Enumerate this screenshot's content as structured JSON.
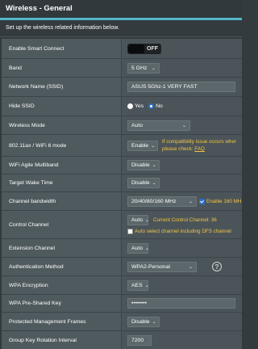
{
  "header": {
    "title": "Wireless - General",
    "description": "Set up the wireless related information below."
  },
  "rows": {
    "smart_connect": {
      "label": "Enable Smart Connect",
      "toggle": "OFF"
    },
    "band": {
      "label": "Band",
      "value": "5 GHz"
    },
    "ssid": {
      "label": "Network Name (SSID)",
      "value": "ASUS 5Ghz-1 VERY FAST"
    },
    "hide_ssid": {
      "label": "Hide SSID",
      "option_yes": "Yes",
      "option_no": "No",
      "selected": "No"
    },
    "wireless_mode": {
      "label": "Wireless Mode",
      "value": "Auto"
    },
    "wifi6": {
      "label": "802.11ax / WiFi 6 mode",
      "value": "Enable",
      "note_line1": "If compatibility issue occurs wher",
      "note_line2_prefix": "please check: ",
      "note_link": "FAQ"
    },
    "agile_multiband": {
      "label": "WiFi Agile Multiband",
      "value": "Disable"
    },
    "target_wake": {
      "label": "Target Wake Time",
      "value": "Disable"
    },
    "channel_bw": {
      "label": "Channel bandwidth",
      "value": "20/40/80/160 MHz",
      "check_label": "Enable 160 MH",
      "checked": true
    },
    "control_channel": {
      "label": "Control Channel",
      "value": "Auto",
      "current": "Current Control Channel: 36",
      "check_label": "Auto select channel including DFS channel",
      "checked": false
    },
    "ext_channel": {
      "label": "Extension Channel",
      "value": "Auto"
    },
    "auth_method": {
      "label": "Authentication Method",
      "value": "WPA2-Personal",
      "help_icon": "question-icon"
    },
    "wpa_encryption": {
      "label": "WPA Encryption",
      "value": "AES"
    },
    "wpa_psk": {
      "label": "WPA Pre-Shared Key",
      "value": "••••••••"
    },
    "pmf": {
      "label": "Protected Management Frames",
      "value": "Disable"
    },
    "group_key": {
      "label": "Group Key Rotation Interval",
      "value": "7200"
    }
  },
  "colors": {
    "accent": "#55b6c8",
    "note": "#f5c242",
    "background": "#333b3f",
    "checkbox": "#2b6ec6"
  }
}
